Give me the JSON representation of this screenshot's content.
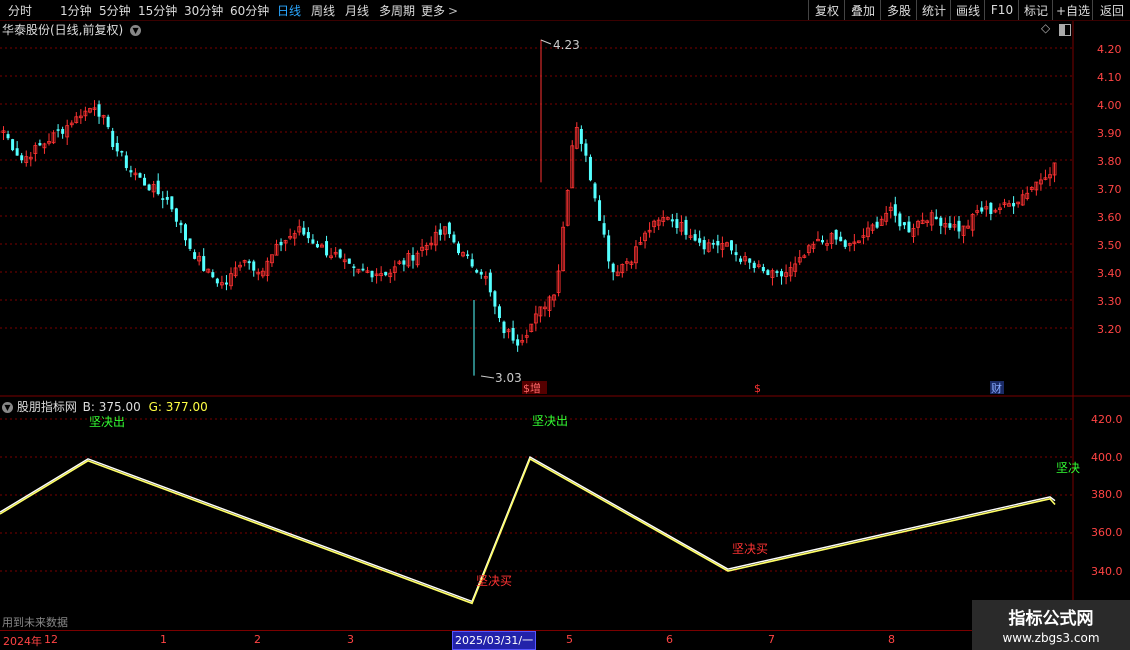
{
  "toolbar": {
    "timeframes": [
      "分时",
      "1分钟",
      "5分钟",
      "15分钟",
      "30分钟",
      "60分钟",
      "日线",
      "周线",
      "月线",
      "多周期",
      "更多"
    ],
    "active": "日线",
    "right_buttons": [
      "复权",
      "叠加",
      "多股",
      "统计",
      "画线",
      "F10",
      "标记",
      "+自选",
      "返回"
    ]
  },
  "stock": {
    "title": "华泰股份(日线,前复权)",
    "price_labels": [
      "4.20",
      "4.10",
      "4.00",
      "3.90",
      "3.80",
      "3.70",
      "3.60",
      "3.50",
      "3.40",
      "3.30",
      "3.20"
    ],
    "high_marker": "4.23",
    "low_marker": "3.03",
    "event_markers": [
      "$增",
      "$",
      "财"
    ]
  },
  "indicator": {
    "name": "股朋指标网",
    "b_label": "B: 375.00",
    "g_label": "G: 377.00",
    "labels": [
      "420.0",
      "400.0",
      "380.0",
      "360.0",
      "340.0"
    ],
    "signals": [
      "坚决出",
      "坚决出",
      "坚决",
      "坚决买",
      "坚决买"
    ],
    "future_note": "用到未来数据"
  },
  "date_axis": {
    "labels": [
      "2024年",
      "12",
      "1",
      "2",
      "3",
      "2025/03/31/一",
      "5",
      "6",
      "7",
      "8"
    ]
  },
  "watermark": {
    "title": "指标公式网",
    "url": "www.zbgs3.com"
  },
  "colors": {
    "up": "#ff3232",
    "down": "#54ffff",
    "line": "#ffff66",
    "grid": "#7a0000",
    "sell": "#33ff33",
    "buy": "#ff3333"
  },
  "chart_data": [
    {
      "type": "candlestick",
      "title": "华泰股份(日线,前复权)",
      "ylim": [
        3.03,
        4.23
      ],
      "y_ticks": [
        4.2,
        4.1,
        4.0,
        3.9,
        3.8,
        3.7,
        3.6,
        3.5,
        3.4,
        3.3,
        3.2
      ],
      "high": 4.23,
      "low": 3.03,
      "close_path": [
        3.9,
        3.8,
        3.85,
        3.9,
        3.95,
        4.0,
        3.85,
        3.75,
        3.7,
        3.65,
        3.5,
        3.4,
        3.35,
        3.45,
        3.4,
        3.5,
        3.55,
        3.5,
        3.45,
        3.4,
        3.4,
        3.4,
        3.45,
        3.5,
        3.55,
        3.45,
        3.4,
        3.2,
        3.15,
        3.25,
        3.35,
        3.95,
        3.7,
        3.4,
        3.45,
        3.55,
        3.6,
        3.55,
        3.5,
        3.5,
        3.45,
        3.4,
        3.38,
        3.42,
        3.5,
        3.52,
        3.48,
        3.55,
        3.62,
        3.55,
        3.6,
        3.58,
        3.55,
        3.62,
        3.62,
        3.66,
        3.72,
        3.78
      ]
    },
    {
      "type": "line",
      "ylim": [
        320,
        430
      ],
      "y_ticks": [
        420,
        400,
        380,
        360,
        340
      ],
      "series": [
        {
          "name": "B",
          "last": 375.0,
          "x_px_hint": "",
          "values": [
            {
              "i": 0,
              "v": 371
            },
            {
              "i": 88,
              "v": 399
            },
            {
              "i": 472,
              "v": 324
            },
            {
              "i": 530,
              "v": 400
            },
            {
              "i": 728,
              "v": 341
            },
            {
              "i": 1050,
              "v": 379
            },
            {
              "i": 1055,
              "v": 377
            }
          ]
        },
        {
          "name": "G",
          "last": 377.0,
          "values": [
            {
              "i": 0,
              "v": 370
            },
            {
              "i": 88,
              "v": 398
            },
            {
              "i": 472,
              "v": 323
            },
            {
              "i": 530,
              "v": 399
            },
            {
              "i": 728,
              "v": 340
            },
            {
              "i": 1050,
              "v": 378
            },
            {
              "i": 1055,
              "v": 375
            }
          ]
        }
      ]
    }
  ]
}
